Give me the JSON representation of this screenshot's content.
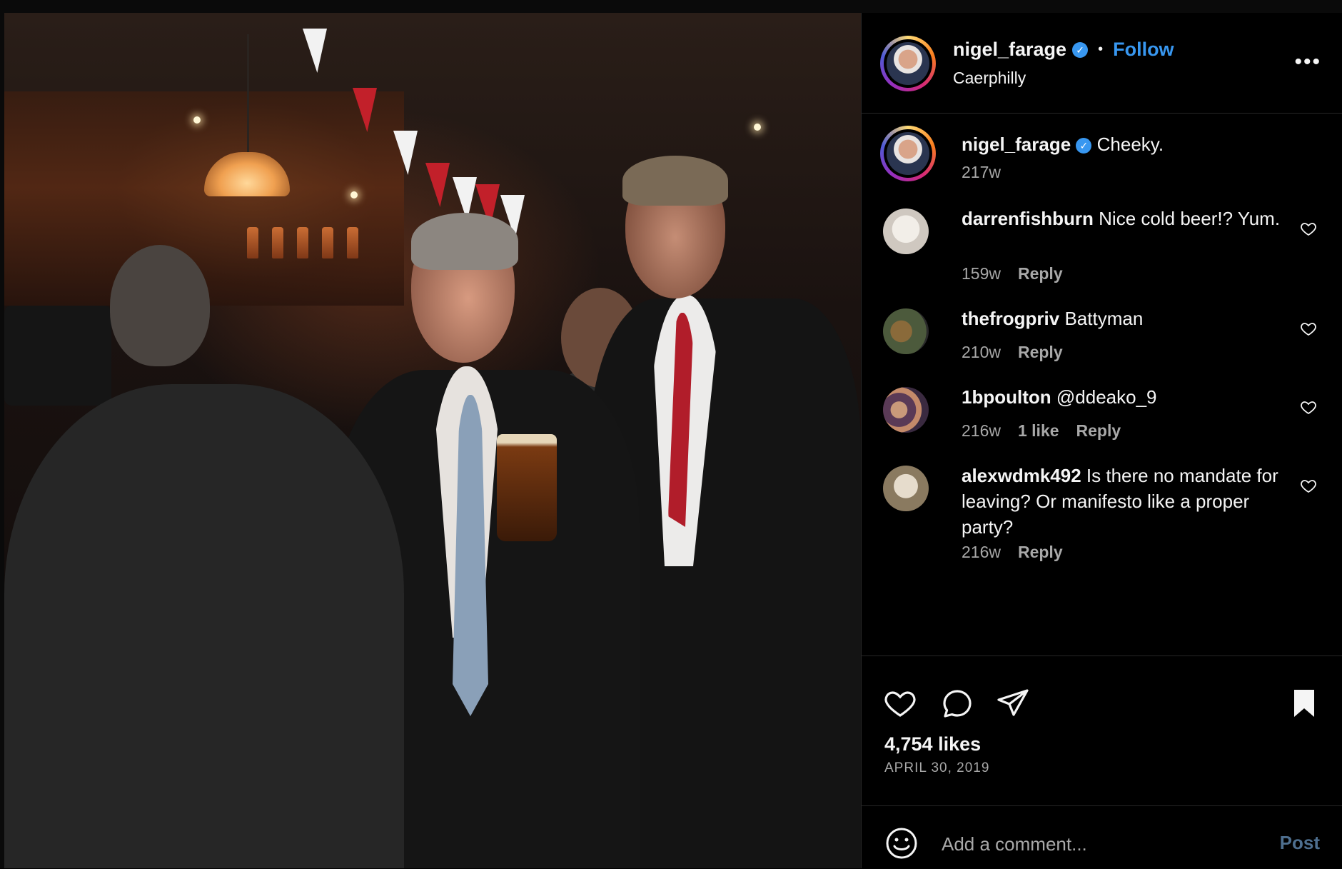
{
  "post": {
    "username": "nigel_farage",
    "follow_label": "Follow",
    "location": "Caerphilly",
    "more_label": "•••",
    "separator": "•"
  },
  "caption": {
    "username": "nigel_farage",
    "text": "Cheeky.",
    "age": "217w"
  },
  "comments": [
    {
      "username": "darrenfishburn",
      "text": "Nice cold beer!? Yum.",
      "age": "159w",
      "likes": "",
      "reply": "Reply"
    },
    {
      "username": "thefrogpriv",
      "text": "Battyman",
      "age": "210w",
      "likes": "",
      "reply": "Reply"
    },
    {
      "username": "1bpoulton",
      "text": "@ddeako_9",
      "age": "216w",
      "likes": "1 like",
      "reply": "Reply"
    },
    {
      "username": "alexwdmk492",
      "text": "Is there no mandate for leaving? Or manifesto like a proper party?",
      "age": "216w",
      "likes": "",
      "reply": "Reply"
    }
  ],
  "actions": {
    "likes": "4,754 likes",
    "date": "APRIL 30, 2019"
  },
  "add_comment": {
    "placeholder": "Add a comment...",
    "post_label": "Post"
  },
  "icons": {
    "like": "heart-icon",
    "comment": "comment-bubble-icon",
    "share": "paper-plane-icon",
    "save": "bookmark-icon",
    "emoji": "smiley-icon",
    "verified": "verified-badge-icon",
    "more": "more-options-icon"
  },
  "colors": {
    "background": "#000000",
    "accent": "#3897f0",
    "muted": "#a8a8a8",
    "post_disabled": "#4e6f8f"
  }
}
